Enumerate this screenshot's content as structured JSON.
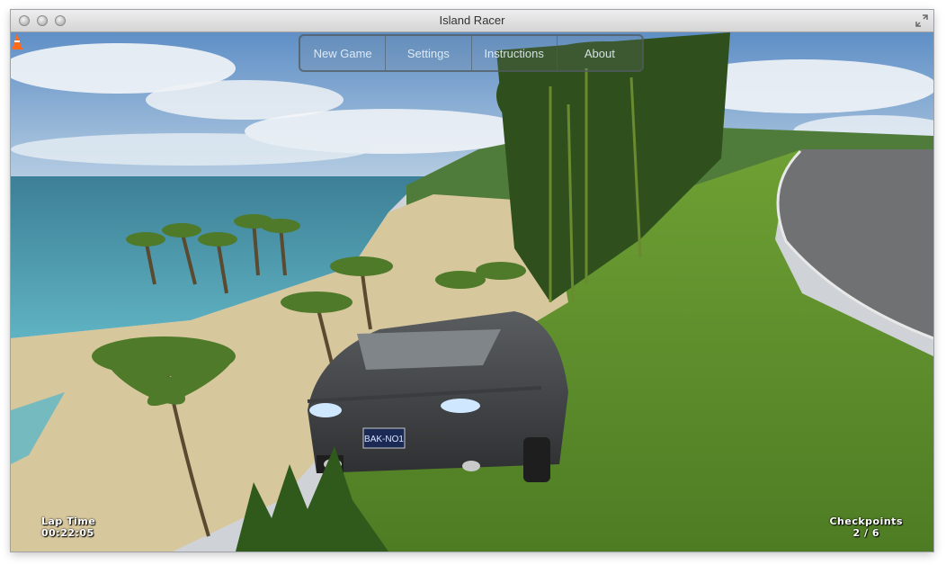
{
  "window": {
    "title": "Island Racer"
  },
  "menu": {
    "items": [
      "New Game",
      "Settings",
      "Instructions",
      "About"
    ]
  },
  "hud": {
    "lap_label": "Lap Time",
    "lap_time": "00:22:05",
    "checkpoints_label": "Checkpoints",
    "checkpoints_value": "2 / 6"
  },
  "car": {
    "plate": "BAK-NO1"
  },
  "icons": {
    "close": "close-button-icon",
    "minimize": "minimize-button-icon",
    "zoom": "zoom-button-icon",
    "fullscreen": "fullscreen-arrows-icon",
    "cone": "traffic-cone-icon"
  },
  "colors": {
    "sky": "#8fb6dc",
    "sea": "#4f9bb0",
    "sand": "#d7c79c",
    "grass": "#5f8f2c",
    "road": "#6f7173",
    "car": "#4b4d4f"
  }
}
